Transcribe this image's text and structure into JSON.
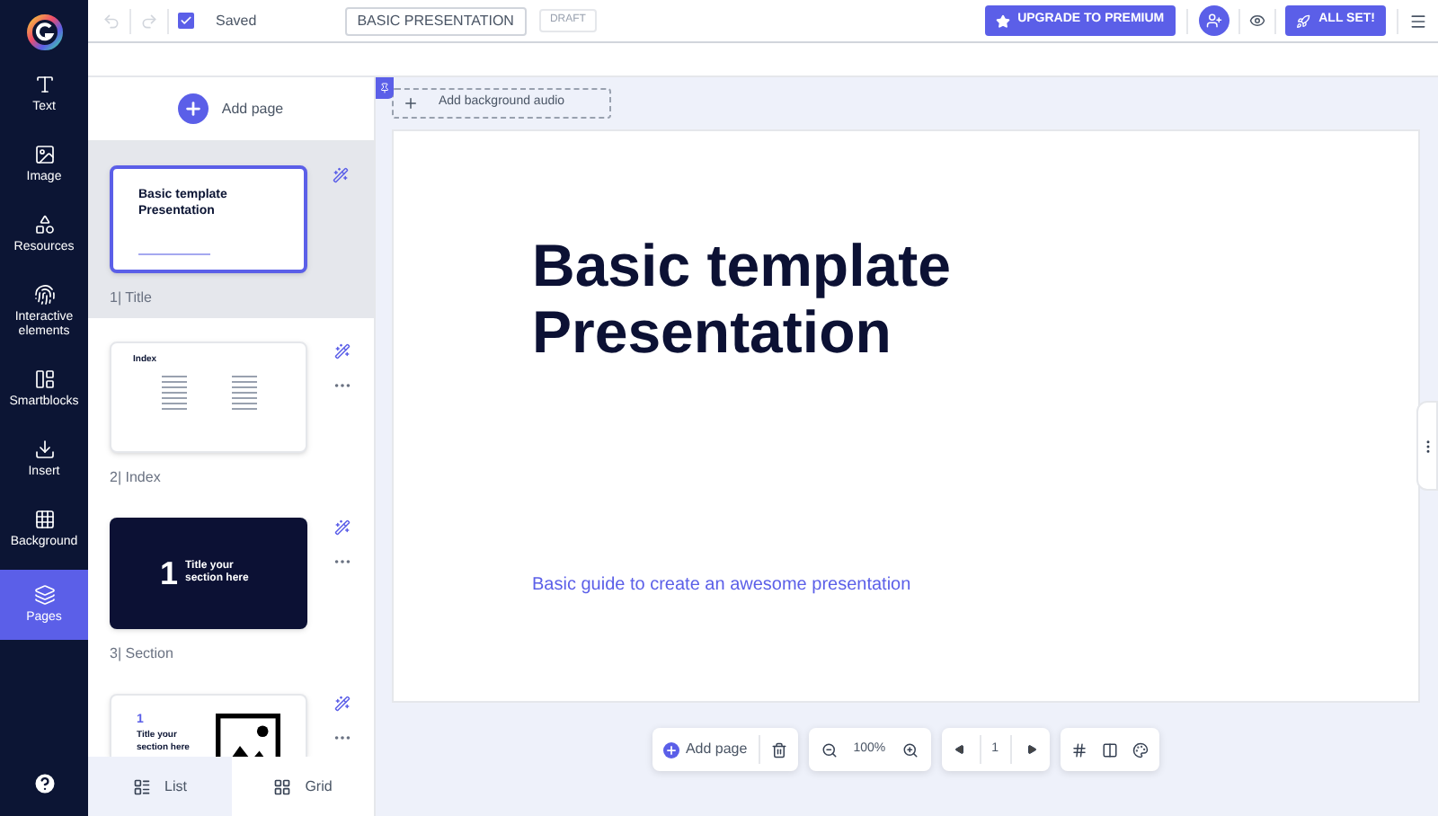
{
  "toolbar": {
    "saved": {
      "label": "Saved",
      "checked": true
    },
    "title": "BASIC PRESENTATION",
    "status": "DRAFT",
    "upgrade": "UPGRADE TO PREMIUM",
    "publish": "ALL SET!"
  },
  "nav": [
    {
      "label": "Text",
      "selected": false
    },
    {
      "label": "Image",
      "selected": false
    },
    {
      "label": "Resources",
      "selected": false
    },
    {
      "label": "Interactive elements",
      "selected": false
    },
    {
      "label": "Smartblocks",
      "selected": false
    },
    {
      "label": "Insert",
      "selected": false
    },
    {
      "label": "Background",
      "selected": false
    },
    {
      "label": "Pages",
      "selected": true
    }
  ],
  "pages_panel": {
    "add_page": "Add page",
    "pages": [
      {
        "kind": "title",
        "number": "1|",
        "name": "Title",
        "selected": true,
        "thumb_title": "Basic template Presentation"
      },
      {
        "kind": "index",
        "number": "2|",
        "name": "Index",
        "selected": false,
        "thumb_title": "Index"
      },
      {
        "kind": "section",
        "number": "3|",
        "name": "Section",
        "selected": false,
        "thumb_number": "1",
        "thumb_title": "Title your section here"
      },
      {
        "kind": "image_section",
        "selected": false,
        "thumb_number": "1",
        "thumb_title": "Title your section here"
      }
    ],
    "views": [
      {
        "label": "List",
        "selected": true
      },
      {
        "label": "Grid",
        "selected": false
      }
    ]
  },
  "canvas": {
    "add_audio": "Add background audio",
    "slide": {
      "title": "Basic template\nPresentation",
      "subtitle": "Basic guide to create an awesome presentation"
    }
  },
  "bottom_bar": {
    "add_page": "Add page",
    "zoom": "100%",
    "page": "1"
  }
}
